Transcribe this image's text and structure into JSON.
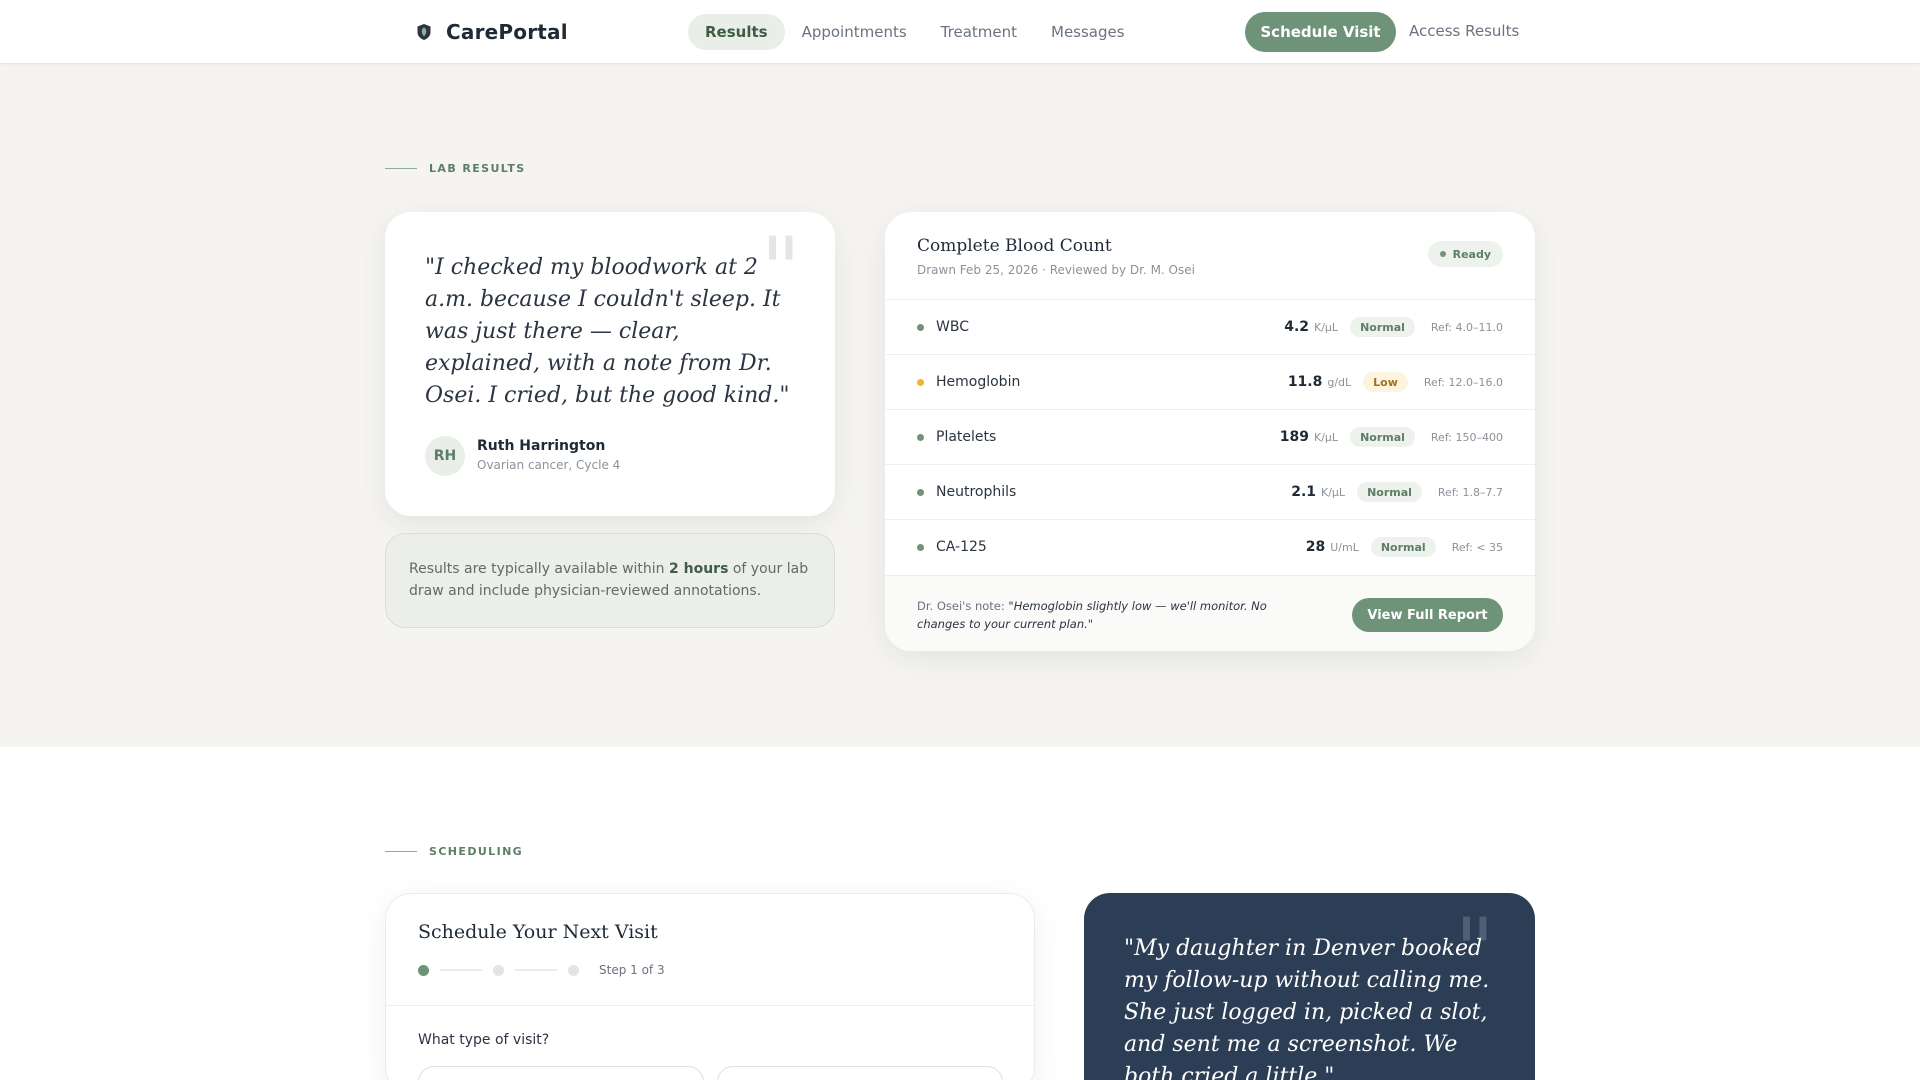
{
  "brand": {
    "name": "CarePortal",
    "icon": "shield-leaf-icon"
  },
  "nav": {
    "links": [
      {
        "label": "Results",
        "active": true
      },
      {
        "label": "Appointments",
        "active": false
      },
      {
        "label": "Treatment",
        "active": false
      },
      {
        "label": "Messages",
        "active": false
      }
    ],
    "cta_label": "Schedule Visit",
    "secondary_label": "Access Results"
  },
  "lab_section": {
    "eyebrow": "LAB RESULTS",
    "testimonial": {
      "quote": "\"I checked my bloodwork at 2 a.m. because I couldn't sleep. It was just there — clear, explained, with a note from Dr. Osei. I cried, but the good kind.\"",
      "initials": "RH",
      "name": "Ruth Harrington",
      "subtitle": "Ovarian cancer, Cycle 4"
    },
    "info": {
      "prefix": "Results are typically available within ",
      "highlight": "2 hours",
      "suffix": " of your lab draw and include physician-reviewed annotations."
    },
    "report": {
      "title": "Complete Blood Count",
      "subtitle": "Drawn Feb 25, 2026 · Reviewed by Dr. M. Osei",
      "status": "Ready",
      "rows": [
        {
          "name": "WBC",
          "value": "4.2",
          "unit": "K/µL",
          "flag": "Normal",
          "ref": "Ref: 4.0–11.0",
          "dot_color": "#6e9378"
        },
        {
          "name": "Hemoglobin",
          "value": "11.8",
          "unit": "g/dL",
          "flag": "Low",
          "ref": "Ref: 12.0–16.0",
          "dot_color": "#f0b429"
        },
        {
          "name": "Platelets",
          "value": "189",
          "unit": "K/µL",
          "flag": "Normal",
          "ref": "Ref: 150–400",
          "dot_color": "#6e9378"
        },
        {
          "name": "Neutrophils",
          "value": "2.1",
          "unit": "K/µL",
          "flag": "Normal",
          "ref": "Ref: 1.8–7.7",
          "dot_color": "#6e9378"
        },
        {
          "name": "CA-125",
          "value": "28",
          "unit": "U/mL",
          "flag": "Normal",
          "ref": "Ref: < 35",
          "dot_color": "#6e9378"
        }
      ],
      "note_label": "Dr. Osei's note: ",
      "note": "\"Hemoglobin slightly low — we'll monitor. No changes to your current plan.\"",
      "button_label": "View Full Report"
    }
  },
  "scheduling_section": {
    "eyebrow": "SCHEDULING",
    "card": {
      "title": "Schedule Your Next Visit",
      "step_label": "Step 1 of 3",
      "question": "What type of visit?"
    },
    "testimonial": {
      "quote": "\"My daughter in Denver booked my follow-up without calling me. She just logged in, picked a slot, and sent me a screenshot. We both cried a little.\""
    }
  },
  "colors": {
    "accent": "#6e9378",
    "warning": "#f0b429",
    "dark_card": "#2c3e55",
    "section_bg": "#f5f4f1"
  }
}
